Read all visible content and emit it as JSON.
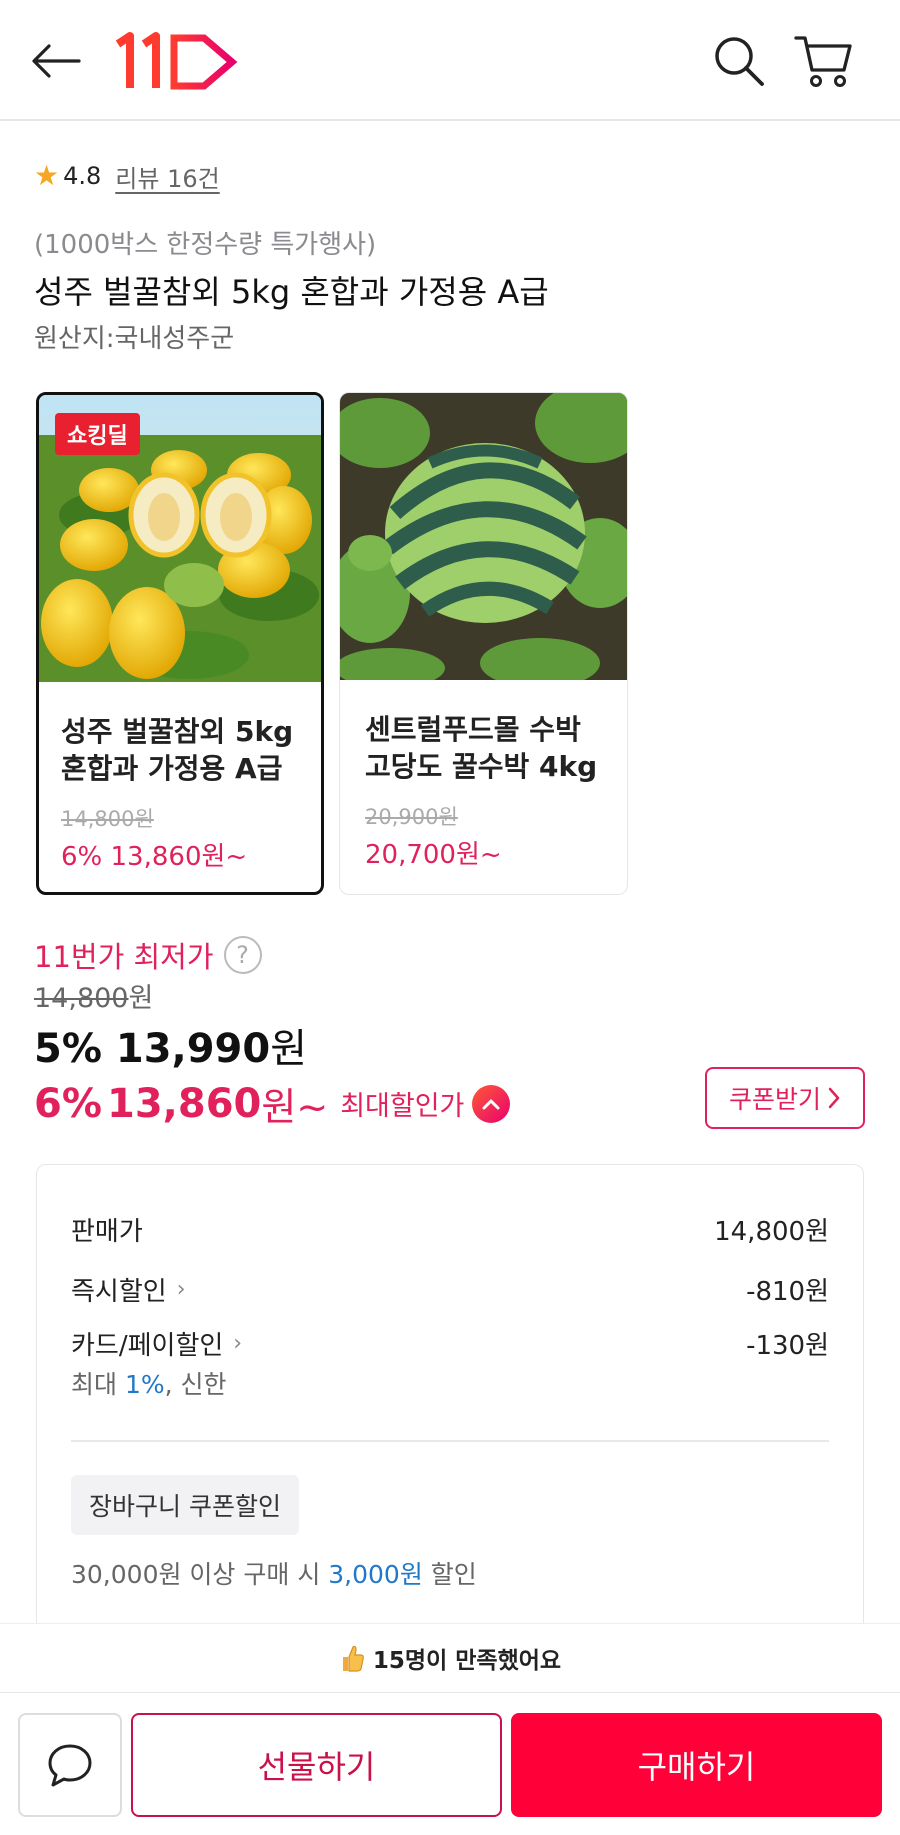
{
  "header": {
    "back_icon": "arrow-left-icon",
    "logo": "11st-logo",
    "search_icon": "search-icon",
    "cart_icon": "cart-icon"
  },
  "rating": {
    "star": "★",
    "score": "4.8",
    "review_link": "리뷰 16건"
  },
  "product": {
    "promo": "(1000박스 한정수량 특가행사)",
    "title": "성주 벌꿀참외 5kg 혼합과 가정용 A급",
    "origin": "원산지:국내성주군"
  },
  "options": [
    {
      "badge": "쇼킹딜",
      "name": "성주 벌꿀참외 5kg 혼합과 가정용 A급",
      "original_price": "14,800원",
      "price": "6% 13,860원~",
      "selected": true
    },
    {
      "name": "센트럴푸드몰 수박 고당도 꿀수박 4kg",
      "original_price": "20,900원",
      "price": "20,700원~",
      "selected": false
    }
  ],
  "pricing": {
    "lowest_label": "11번가 최저가",
    "help": "?",
    "original": "14,800",
    "original_unit": "원",
    "sale_pct": "5%",
    "sale_amount": "13,990",
    "sale_unit": "원",
    "max_pct": "6%",
    "max_amount": "13,860",
    "max_unit": "원~",
    "max_label": "최대할인가",
    "coupon_button": "쿠폰받기",
    "accent_color": "#e0215c"
  },
  "breakdown": {
    "list_price_label": "판매가",
    "list_price": "14,800원",
    "instant_label": "즉시할인",
    "instant_value": "-810원",
    "card_label": "카드/페이할인",
    "card_value": "-130원",
    "card_sub_prefix": "최대 ",
    "card_sub_pct": "1%",
    "card_sub_suffix": ", 신한",
    "basket_chip": "장바구니 쿠폰할인",
    "basket_prefix": "30,000원 이상 구매 시 ",
    "basket_amount": "3,000원",
    "basket_suffix": " 할인"
  },
  "satisfaction": {
    "icon": "thumbs-up-icon",
    "text": "15명이 만족했어요"
  },
  "bottom": {
    "chat_icon": "chat-bubble-icon",
    "gift_button": "선물하기",
    "buy_button": "구매하기",
    "buy_color": "#ff0038"
  }
}
